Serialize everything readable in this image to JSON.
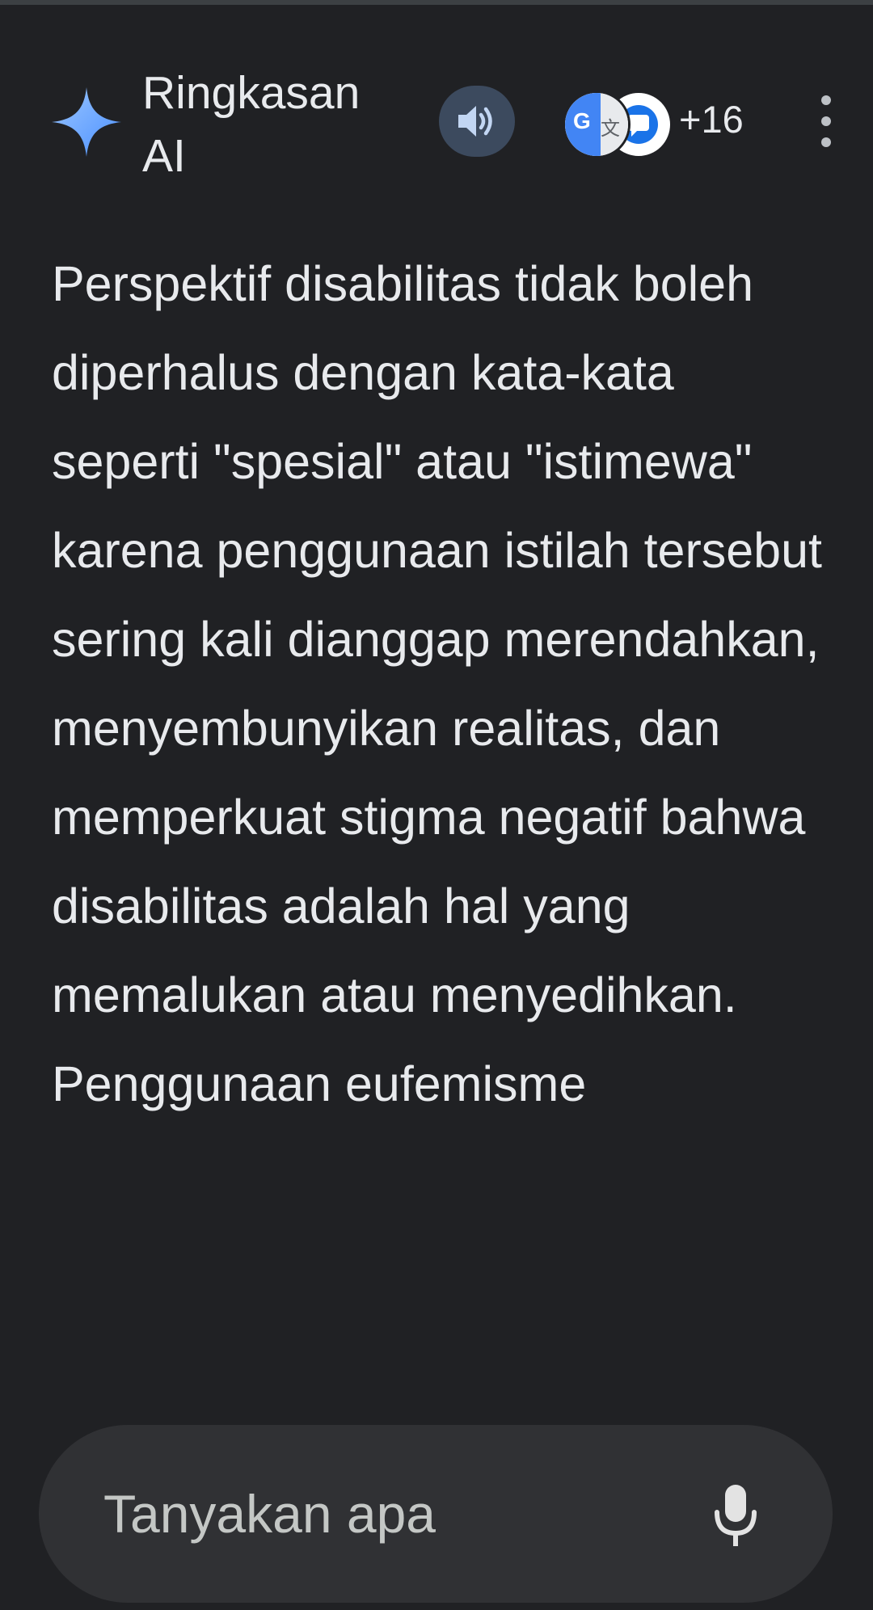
{
  "header": {
    "title": "Ringkasan AI",
    "sparkle_icon": "sparkle-icon",
    "audio_icon": "speaker-icon",
    "sources_count": "+16",
    "more_icon": "more-vert-icon"
  },
  "summary": {
    "text": "Perspektif disabilitas tidak boleh diperhalus dengan kata-kata seperti \"spesial\" atau \"istimewa\" karena penggunaan istilah tersebut sering kali dianggap merendahkan, menyembunyikan realitas, dan memperkuat stigma negatif bahwa disabilitas adalah hal yang memalukan atau menyedihkan. Penggunaan eufemisme"
  },
  "ask": {
    "placeholder": "Tanyakan apa",
    "mic_icon": "mic-icon"
  },
  "colors": {
    "background": "#202124",
    "text": "#e8eaed",
    "audio_button_bg": "#3c4a5e",
    "ask_bar_bg": "#303134",
    "sparkle_blue": "#7fb6ff",
    "chat_icon_blue": "#1a73e8"
  }
}
